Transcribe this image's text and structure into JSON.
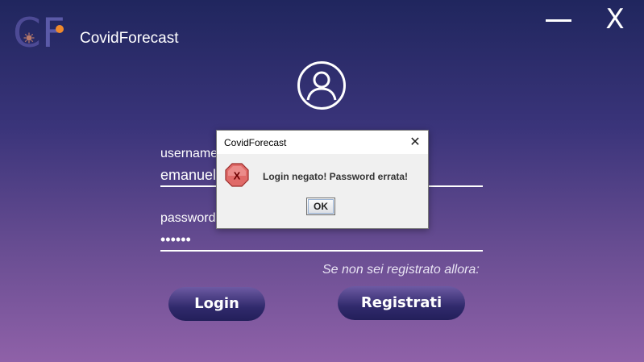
{
  "app": {
    "title": "CovidForecast",
    "logo_text": "CF"
  },
  "window_controls": {
    "minimize_icon": "minimize-icon",
    "close_label": "X"
  },
  "login_form": {
    "username_label": "username",
    "username_value": "emanuel",
    "password_label": "password",
    "password_value": "••••••",
    "register_hint": "Se non sei registrato allora:",
    "login_button": "Login",
    "register_button": "Registrati"
  },
  "dialog": {
    "title": "CovidForecast",
    "message": "Login negato! Password errata!",
    "ok_button": "OK",
    "error_icon_label": "X"
  },
  "colors": {
    "background_top": "#20265e",
    "background_bottom": "#8f61a8",
    "button": "#2a2566",
    "error_icon": "#d9534f"
  }
}
